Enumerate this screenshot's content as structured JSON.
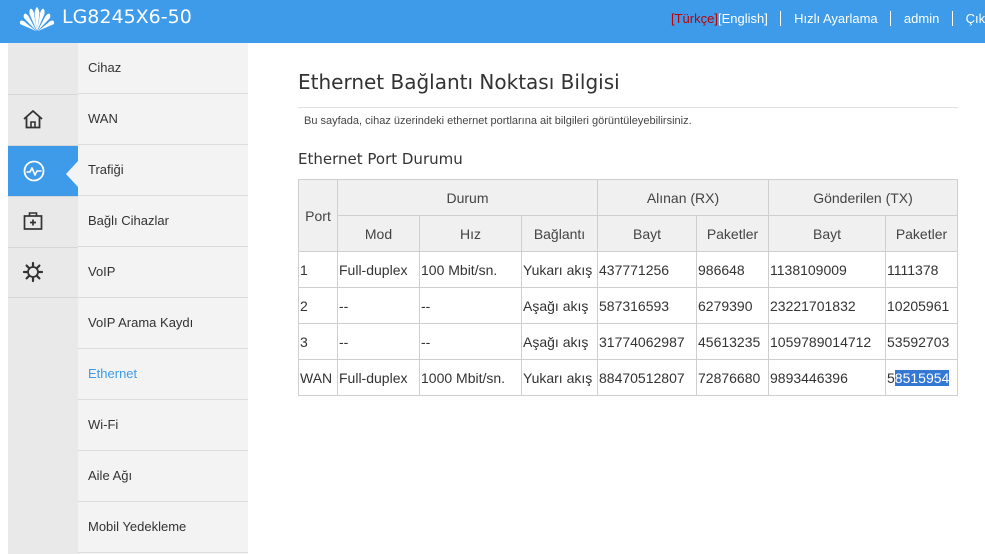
{
  "header": {
    "model": "LG8245X6-50",
    "lang_tr": "[Türkçe]",
    "lang_en": "[English]",
    "quick_setup": "Hızlı Ayarlama",
    "user": "admin",
    "logout": "Çıkış yap",
    "colors": {
      "bar": "#3d9be9",
      "lang_active": "#c00000"
    }
  },
  "icons": [
    {
      "name": "home-icon"
    },
    {
      "name": "traffic-monitor-icon",
      "active": true
    },
    {
      "name": "medical-kit-icon"
    },
    {
      "name": "gear-icon"
    }
  ],
  "menu": {
    "items": [
      {
        "label": "Cihaz"
      },
      {
        "label": "WAN"
      },
      {
        "label": "Trafiği"
      },
      {
        "label": "Bağlı Cihazlar"
      },
      {
        "label": "VoIP"
      },
      {
        "label": "VoIP Arama Kaydı"
      },
      {
        "label": "Ethernet",
        "active": true
      },
      {
        "label": "Wi-Fi"
      },
      {
        "label": "Aile Ağı"
      },
      {
        "label": "Mobil Yedekleme"
      }
    ]
  },
  "page": {
    "title": "Ethernet Bağlantı Noktası Bilgisi",
    "description": "Bu sayfada, cihaz üzerindeki ethernet portlarına ait bilgileri görüntüleyebilirsiniz.",
    "section_title": "Ethernet Port Durumu"
  },
  "table": {
    "headers": {
      "port": "Port",
      "durum": "Durum",
      "rx": "Alınan (RX)",
      "tx": "Gönderilen (TX)",
      "mod": "Mod",
      "hiz": "Hız",
      "baglanti": "Bağlantı",
      "rx_bayt": "Bayt",
      "rx_paket": "Paketler",
      "tx_bayt": "Bayt",
      "tx_paket": "Paketler"
    },
    "rows": [
      [
        "1",
        "Full-duplex",
        "100 Mbit/sn.",
        "Yukarı akış",
        "437771256",
        "986648",
        "1138109009",
        "1111378"
      ],
      [
        "2",
        "--",
        "--",
        "Aşağı akış",
        "587316593",
        "6279390",
        "23221701832",
        "10205961"
      ],
      [
        "3",
        "--",
        "--",
        "Aşağı akış",
        "31774062987",
        "45613235",
        "1059789014712",
        "53592703"
      ],
      [
        "WAN",
        "Full-duplex",
        "1000 Mbit/sn.",
        "Yukarı akış",
        "88470512807",
        "72876680",
        "9893446396",
        "58515954"
      ]
    ],
    "selection": {
      "row": 3,
      "col": 7,
      "prefix": "5",
      "selected": "8515954"
    }
  }
}
